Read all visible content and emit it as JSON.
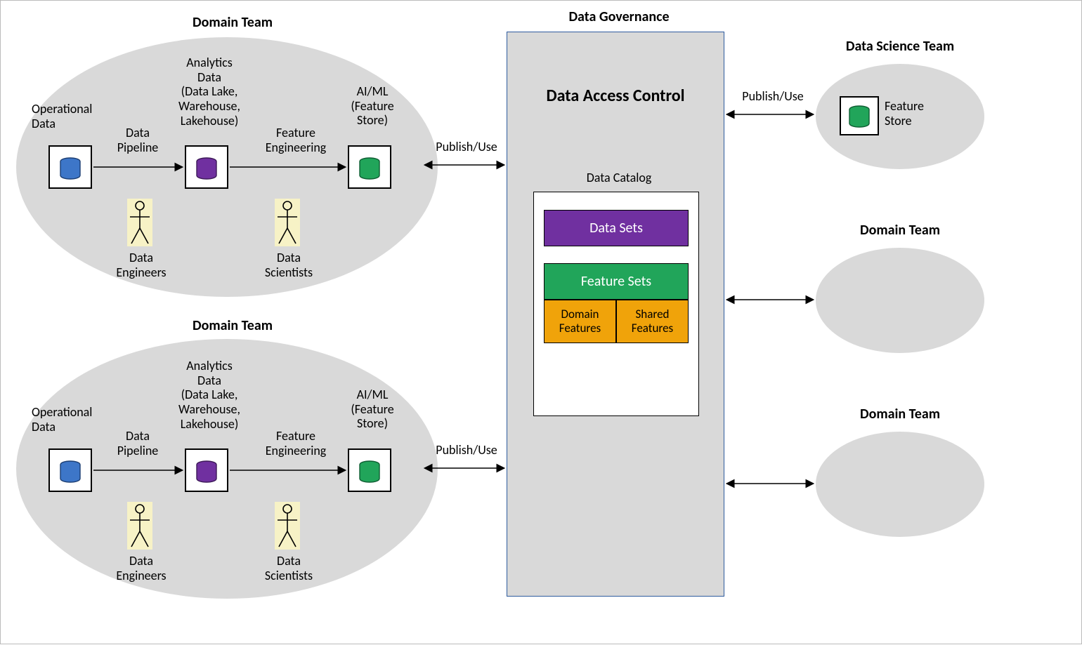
{
  "titles": {
    "domain_team": "Domain Team",
    "data_governance": "Data Governance",
    "data_science_team": "Data Science Team",
    "data_access_control": "Data Access Control"
  },
  "domain": {
    "operational_data": "Operational\nData",
    "data_pipeline": "Data\nPipeline",
    "analytics_data": "Analytics\nData\n(Data Lake,\nWarehouse,\nLakehouse)",
    "feature_engineering": "Feature\nEngineering",
    "aiml": "AI/ML\n(Feature\nStore)",
    "data_engineers": "Data\nEngineers",
    "data_scientists": "Data\nScientists"
  },
  "actions": {
    "publish_use": "Publish/Use"
  },
  "catalog": {
    "title": "Data Catalog",
    "data_sets": "Data Sets",
    "feature_sets": "Feature Sets",
    "domain_features": "Domain\nFeatures",
    "shared_features": "Shared\nFeatures"
  },
  "right": {
    "feature_store": "Feature\nStore"
  },
  "colors": {
    "blue": "#3d76c8",
    "purple": "#7030a0",
    "green": "#21a55a",
    "orange": "#f0a30a"
  }
}
